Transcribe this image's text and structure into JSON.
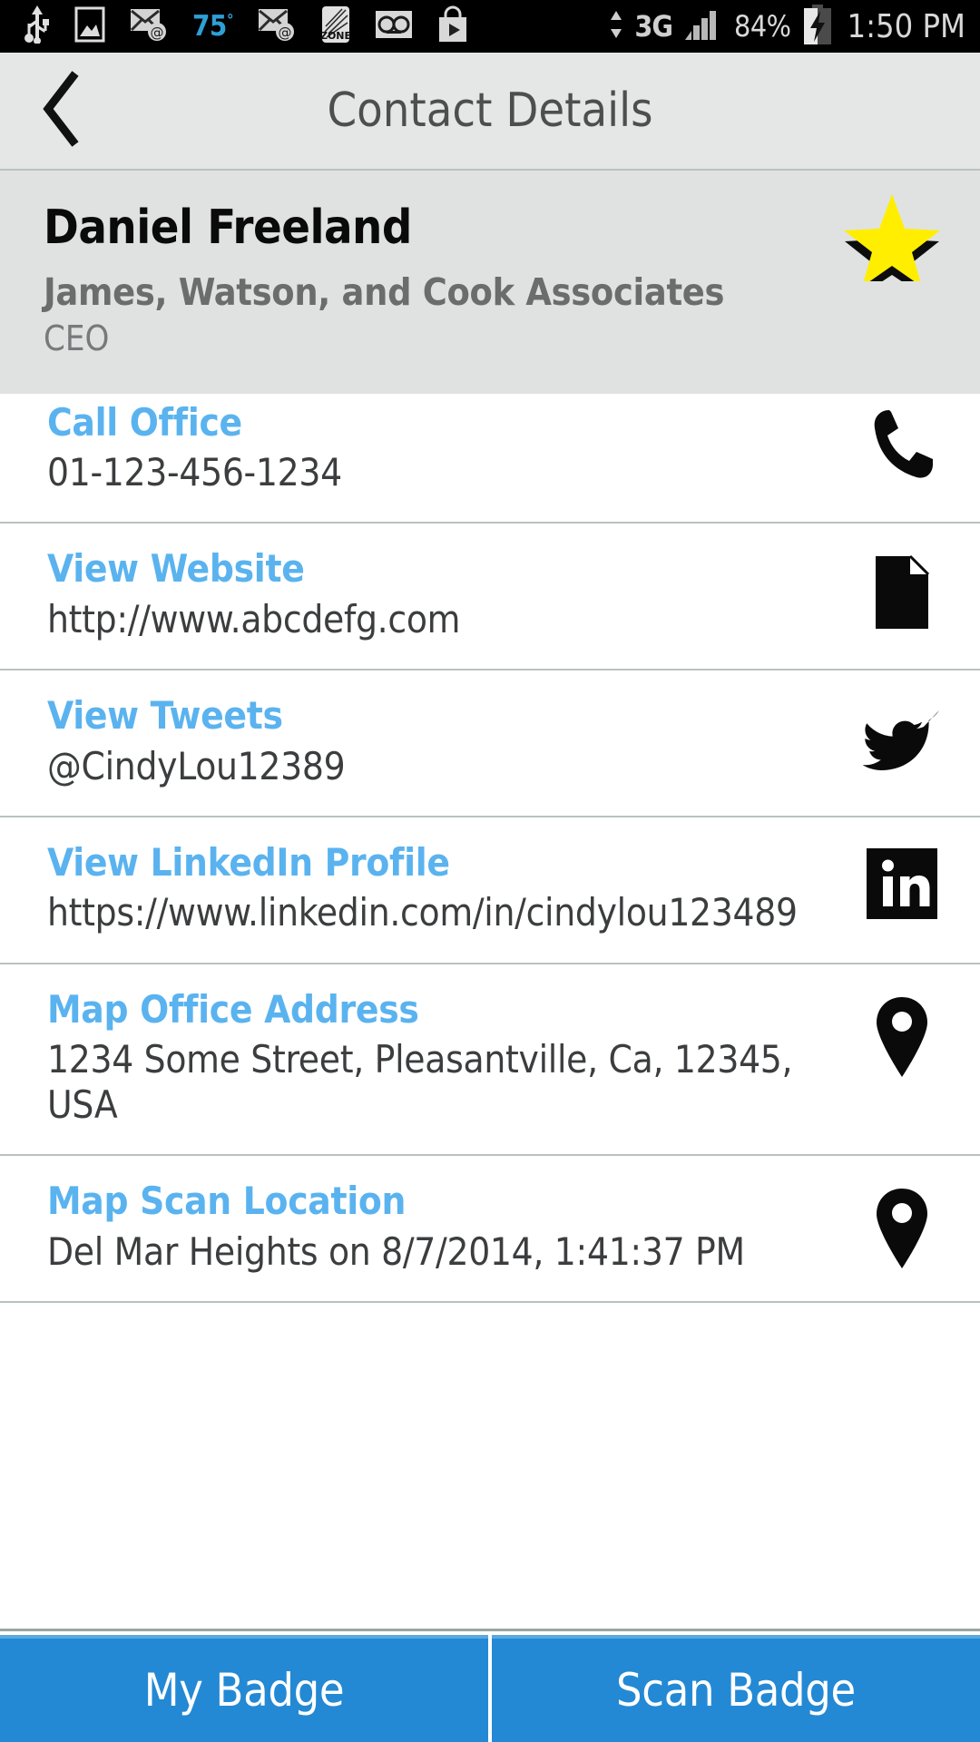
{
  "statusbar": {
    "icons": [
      "usb-icon",
      "gallery-icon",
      "email-at-icon",
      "weather-temp",
      "email-at-icon-2",
      "zone-icon",
      "voicemail-icon",
      "play-store-icon",
      "data-arrows-icon"
    ],
    "temperature": "75",
    "degree": "°",
    "network": "3G",
    "battery_percent": "84%",
    "time": "1:50 PM"
  },
  "header": {
    "back_label": "Back",
    "title": "Contact Details"
  },
  "contact": {
    "name": "Daniel Freeland",
    "company": "James, Watson, and Cook Associates",
    "role": "CEO",
    "favorite": true,
    "star_color": "#ffee00"
  },
  "rows": [
    {
      "label": "Call Office",
      "value": "01-123-456-1234",
      "icon": "phone-icon"
    },
    {
      "label": "View Website",
      "value": "http://www.abcdefg.com",
      "icon": "document-icon"
    },
    {
      "label": "View Tweets",
      "value": "@CindyLou12389",
      "icon": "twitter-icon"
    },
    {
      "label": "View LinkedIn Profile",
      "value": "https://www.linkedin.com/in/cindylou123489",
      "icon": "linkedin-icon"
    },
    {
      "label": "Map Office Address",
      "value": "1234 Some Street, Pleasantville, Ca, 12345, USA",
      "icon": "map-pin-icon"
    },
    {
      "label": "Map Scan Location",
      "value": "Del Mar Heights on 8/7/2014, 1:41:37 PM",
      "icon": "map-pin-icon"
    }
  ],
  "bottom": {
    "my_badge": "My Badge",
    "scan_badge": "Scan Badge"
  },
  "colors": {
    "link": "#5ab3ef",
    "button": "#2489d4",
    "header_bg": "#e4e7e6",
    "card_bg": "#e0e2e1",
    "divider": "#b9c2c0"
  }
}
